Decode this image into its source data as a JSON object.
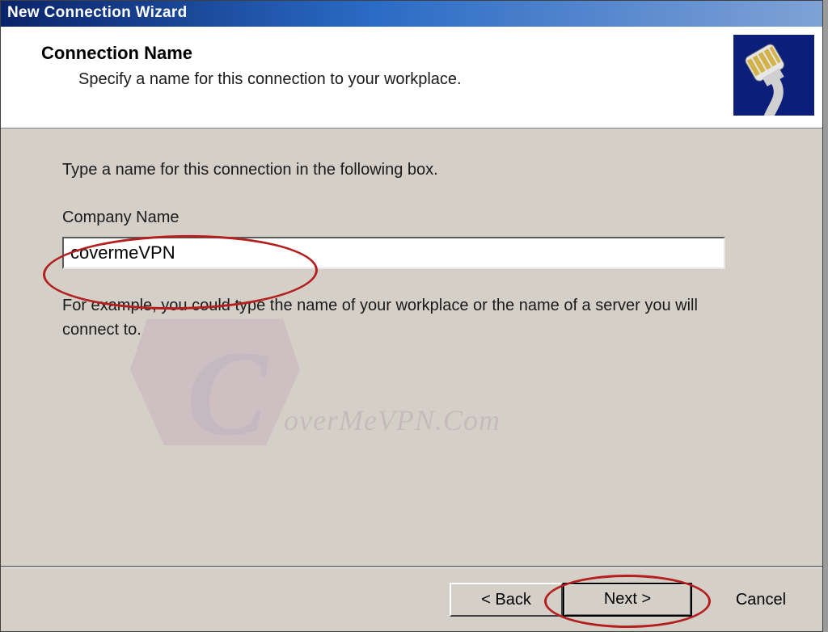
{
  "window": {
    "title": "New Connection Wizard"
  },
  "header": {
    "title": "Connection Name",
    "subtitle": "Specify a name for this connection to your workplace."
  },
  "body": {
    "instruction": "Type a name for this connection in the following box.",
    "field_label": "Company Name",
    "field_value": "covermeVPN",
    "example": "For example, you could type the name of your workplace or the name of a server you will connect to."
  },
  "footer": {
    "back": "< Back",
    "next": "Next >",
    "cancel": "Cancel"
  },
  "watermark": {
    "text": "overMeVPN.Com"
  }
}
